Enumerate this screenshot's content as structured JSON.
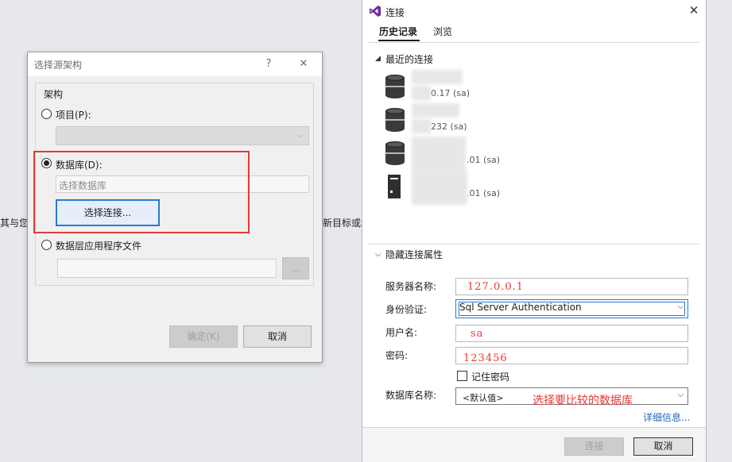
{
  "background": {
    "left_fragment": "其与您涩",
    "right_fragment": "新目标或编"
  },
  "schema_dialog": {
    "title": "选择源架构",
    "help_label": "?",
    "close_label": "✕",
    "group_label": "架构",
    "project_radio": "项目(P):",
    "database_radio": "数据库(D):",
    "database_placeholder": "选择数据库",
    "select_connection_button": "选择连接...",
    "dacpac_radio": "数据层应用程序文件",
    "browse_button": "...",
    "ok_button": "确定(K)",
    "cancel_button": "取消"
  },
  "connect_panel": {
    "title": "连接",
    "close_label": "✕",
    "tabs": [
      {
        "label": "历史记录",
        "active": true
      },
      {
        "label": "浏览",
        "active": false
      }
    ],
    "recent_header": "最近的连接",
    "recent_connections": [
      {
        "name": "",
        "detail": "0.17 (sa)",
        "icon": "database-icon"
      },
      {
        "name": "",
        "detail": "232 (sa)",
        "icon": "database-icon"
      },
      {
        "name": "",
        "detail": ".01 (sa)",
        "icon": "database-icon"
      },
      {
        "name": "",
        "detail": ".01 (sa)",
        "icon": "server-icon"
      }
    ],
    "props_header": "隐藏连接属性",
    "server_label": "服务器名称:",
    "server_value": "127.0.0.1",
    "auth_label": "身份验证:",
    "auth_value": "Sql Server Authentication",
    "user_label": "用户名:",
    "user_value": "sa",
    "password_label": "密码:",
    "password_value": "123456",
    "remember_label": "记住密码",
    "db_label": "数据库名称:",
    "db_value": "<默认值>",
    "annotation": "选择要比较的数据库",
    "details_link": "详细信息...",
    "connect_button": "连接",
    "cancel_button": "取消"
  },
  "colors": {
    "highlight_red": "#e53935",
    "focus_blue": "#2b79d5",
    "vs_purple": "#6c2d9c"
  }
}
